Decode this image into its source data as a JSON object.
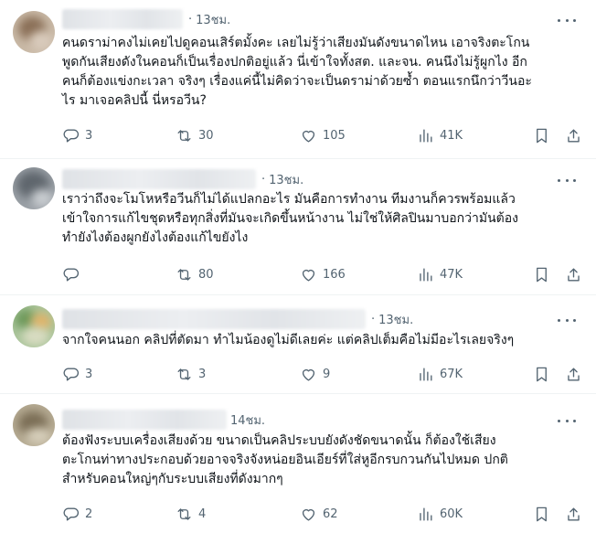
{
  "colors": {
    "text_primary": "#0f1419",
    "text_secondary": "#536471",
    "divider": "#eff3f4"
  },
  "icons": {
    "reply": "reply-icon",
    "retweet": "retweet-icon",
    "like": "heart-icon",
    "views": "views-icon",
    "bookmark": "bookmark-icon",
    "share": "share-icon",
    "more": "more-icon"
  },
  "posts": [
    {
      "time": "13ชม.",
      "text": "คนดราม่าคงไม่เคยไปดูคอนเสิร์ตมั้งคะ เลยไม่รู้ว่าเสียงมันดังขนาดไหน เอาจริงตะโกน\nพูดกันเสียงดังในคอนก็เป็นเรื่องปกติอยู่แล้ว นี่เข้าใจทั้งสต. และจน. คนนึงไม่รู้ผูกไง อีก\nคนก็ต้องแข่งกะเวลา จริงๆ เรื่องแค่นี้ไม่คิดว่าจะเป็นดราม่าด้วยซ้ำ ตอนแรกนึกว่าวีนอะ\nไร มาเจอคลิปนี้ นี่หรอวีน?",
      "replies": "3",
      "retweets": "30",
      "likes": "105",
      "views": "41K"
    },
    {
      "time": "13ชม.",
      "text": "เราว่าถึงจะโมโหหรือวีนก็ไม่ได้แปลกอะไร มันคือการทำงาน ทีมงานก็ควรพร้อมแล้ว\nเข้าใจการแก้ไขชุดหรือทุกสิ่งที่มันจะเกิดขึ้นหน้างาน ไม่ใช่ให้ศิลปินมาบอกว่ามันต้อง\nทำยังไงต้องผูกยังไงต้องแก้ไขยังไง",
      "replies": "",
      "retweets": "80",
      "likes": "166",
      "views": "47K"
    },
    {
      "time": "13ชม.",
      "text": "จากใจคนนอก คลิปที่ตัดมา ทำไมน้องดูไม่ดีเลยค่ะ แต่คลิปเต็มคือไม่มีอะไรเลยจริงๆ",
      "replies": "3",
      "retweets": "3",
      "likes": "9",
      "views": "67K"
    },
    {
      "time": "14ชม.",
      "text": "ต้องฟังระบบเครื่องเสียงด้วย ขนาดเป็นคลิประบบยังดังชัดขนาดนั้น ก็ต้องใช้เสียง\nตะโกนท่าทางประกอบด้วยอาจจริงจังหน่อยอินเอียร์ที่ใส่หูอีกรบกวนกันไปหมด ปกติ\nสำหรับคอนใหญ่ๆกับระบบเสียงที่ดังมากๆ",
      "replies": "2",
      "retweets": "4",
      "likes": "62",
      "views": "60K"
    }
  ]
}
